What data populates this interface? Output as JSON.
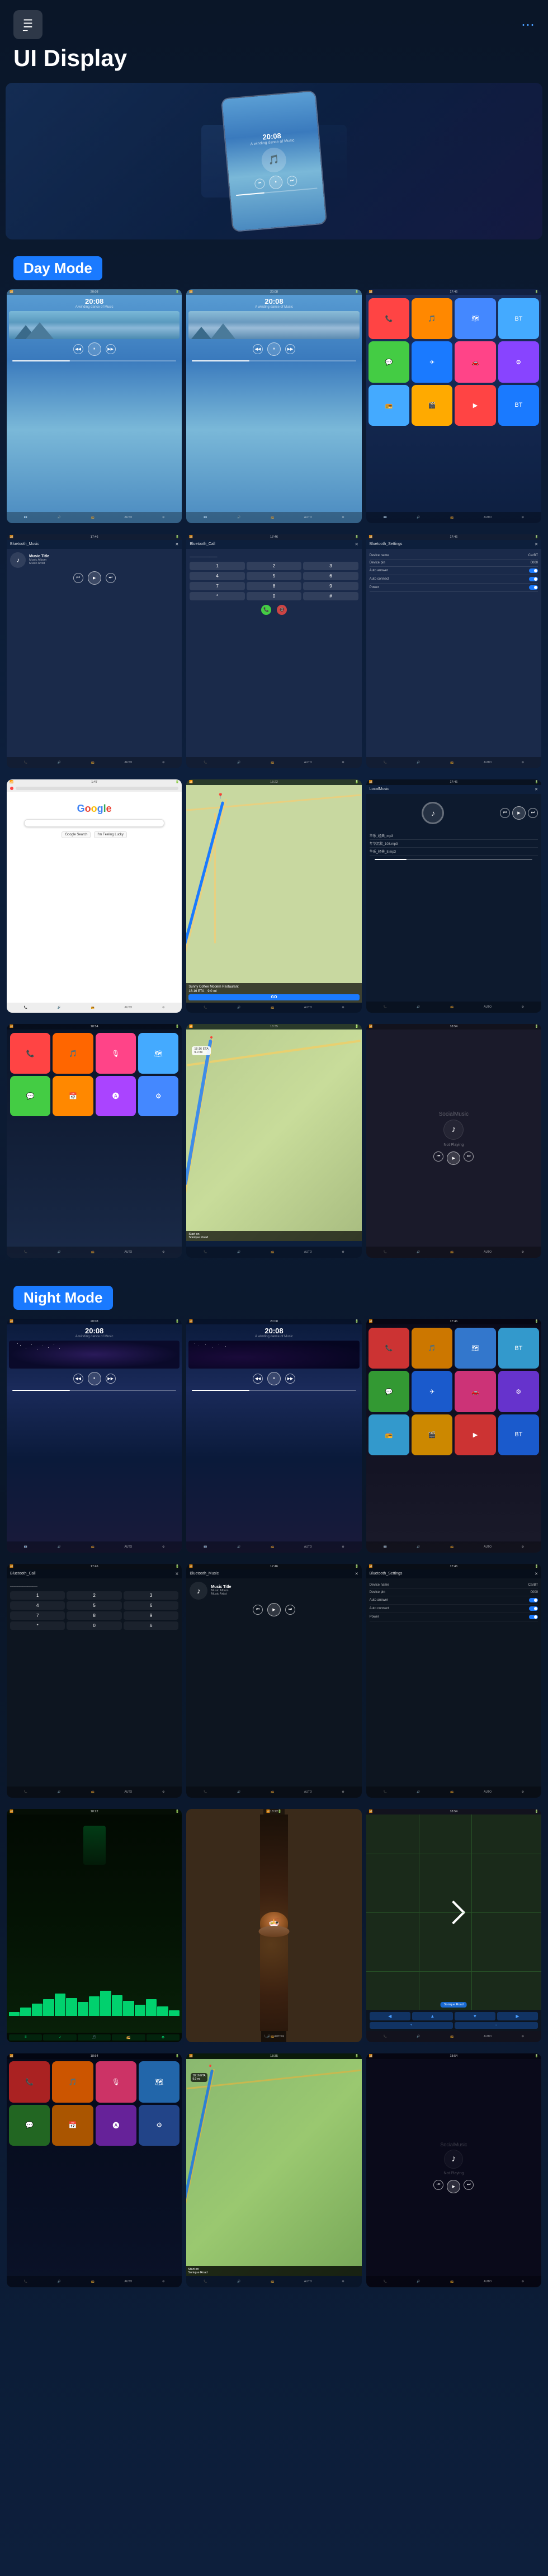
{
  "header": {
    "title": "UI Display",
    "menu_label": "☰",
    "hamburger_lines": "≡",
    "dots_menu": "⋮"
  },
  "sections": {
    "day_mode": "Day Mode",
    "night_mode": "Night Mode"
  },
  "device_time": "20:08",
  "device_subtitle": "A winding dance of Music",
  "music": {
    "title": "Music Title",
    "album": "Music Album",
    "artist": "Music Artist"
  },
  "navigation": {
    "destination": "Sunny Coffee Modern Restaurant",
    "eta": "18:16 ETA",
    "distance": "9.0 mi",
    "go_label": "GO",
    "start_on": "Start on",
    "road": "Sonique Road"
  },
  "not_playing": "Not Playing",
  "bluetooth": {
    "music_label": "Bluetooth_Music",
    "call_label": "Bluetooth_Call",
    "settings_label": "Bluetooth_Settings"
  },
  "settings": {
    "device_name": "Device name",
    "device_pin": "Device pin",
    "auto_answer": "Auto answer",
    "auto_connect": "Auto connect",
    "power": "Power",
    "carbt_value": "CarBT",
    "pin_value": "0000"
  },
  "local_music": {
    "label": "LocalMusic",
    "file1": "华乐_经典_mp3",
    "file2": "年华沉默_103.mp3",
    "file3": "华乐_经典_8.mp3"
  },
  "icons": {
    "phone": "📞",
    "music": "🎵",
    "map": "🗺",
    "settings": "⚙",
    "back": "◀",
    "play": "▶",
    "pause": "⏸",
    "prev": "⏮",
    "next": "⏭",
    "search": "🔍",
    "home": "⌂",
    "bt": "bluetooth"
  },
  "colors": {
    "accent_blue": "#1a7aff",
    "day_bg": "#5a9ed4",
    "night_bg": "#0a1628",
    "section_label_bg": "#1a7aff"
  }
}
